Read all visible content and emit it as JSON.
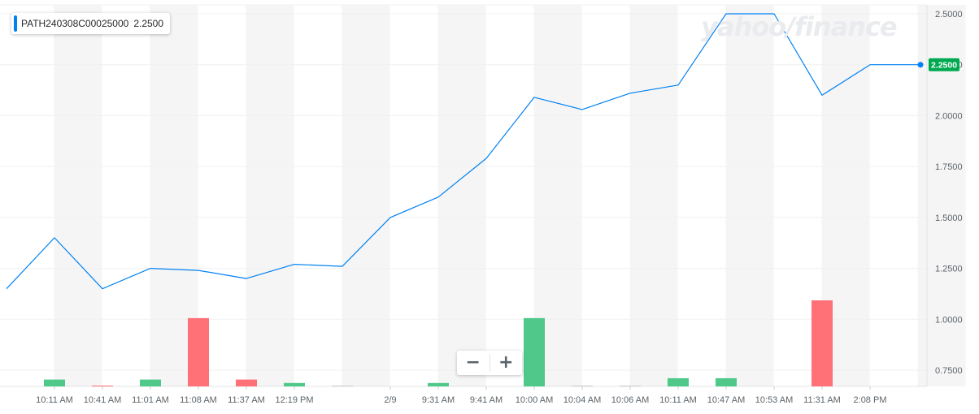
{
  "legend": {
    "symbol": "PATH240308C00025000",
    "value": "2.2500"
  },
  "logo_text": "yahoo/finance",
  "zoom": {
    "minus": "−",
    "plus": "+"
  },
  "colors": {
    "line": "#0081f2",
    "up": "#4fc88a",
    "down": "#ff7077",
    "price_tag": "#00a94f",
    "band": "#f5f5f5",
    "grid": "#f0f0f0",
    "axis_text": "#5b636a"
  },
  "chart_data": {
    "type": "line",
    "title": "",
    "x": [
      "",
      "10:11 AM",
      "10:41 AM",
      "11:01 AM",
      "11:08 AM",
      "11:37 AM",
      "12:19 PM",
      "",
      "2/9",
      "9:31 AM",
      "9:41 AM",
      "10:00 AM",
      "10:04 AM",
      "10:06 AM",
      "10:11 AM",
      "10:47 AM",
      "10:53 AM",
      "11:31 AM",
      "2:08 PM",
      ""
    ],
    "series": [
      {
        "name": "PATH240308C00025000",
        "values": [
          1.15,
          1.4,
          1.15,
          1.25,
          1.24,
          1.2,
          1.27,
          1.26,
          1.5,
          1.6,
          1.79,
          2.09,
          2.03,
          2.11,
          2.15,
          2.5,
          2.5,
          2.1,
          2.25,
          2.25
        ]
      }
    ],
    "volume": {
      "values": [
        0,
        0.05,
        0.005,
        0.05,
        0.5,
        0.05,
        0.025,
        0.005,
        0,
        0.025,
        0,
        0.5,
        0.005,
        0.005,
        0.06,
        0.06,
        0,
        0.63,
        0,
        0
      ],
      "direction": [
        "",
        "up",
        "down",
        "up",
        "down",
        "down",
        "up",
        "",
        "",
        "up",
        "",
        "up",
        "",
        "",
        "up",
        "up",
        "",
        "down",
        "",
        ""
      ]
    },
    "y_ticks": [
      "2.5000",
      "2.2500",
      "2.0000",
      "1.7500",
      "1.5000",
      "1.2500",
      "1.0000",
      "0.7500"
    ],
    "ylim": [
      0.69,
      2.52
    ],
    "last_price_label": "2.2500",
    "grid": true,
    "legend_position": "top-left"
  }
}
